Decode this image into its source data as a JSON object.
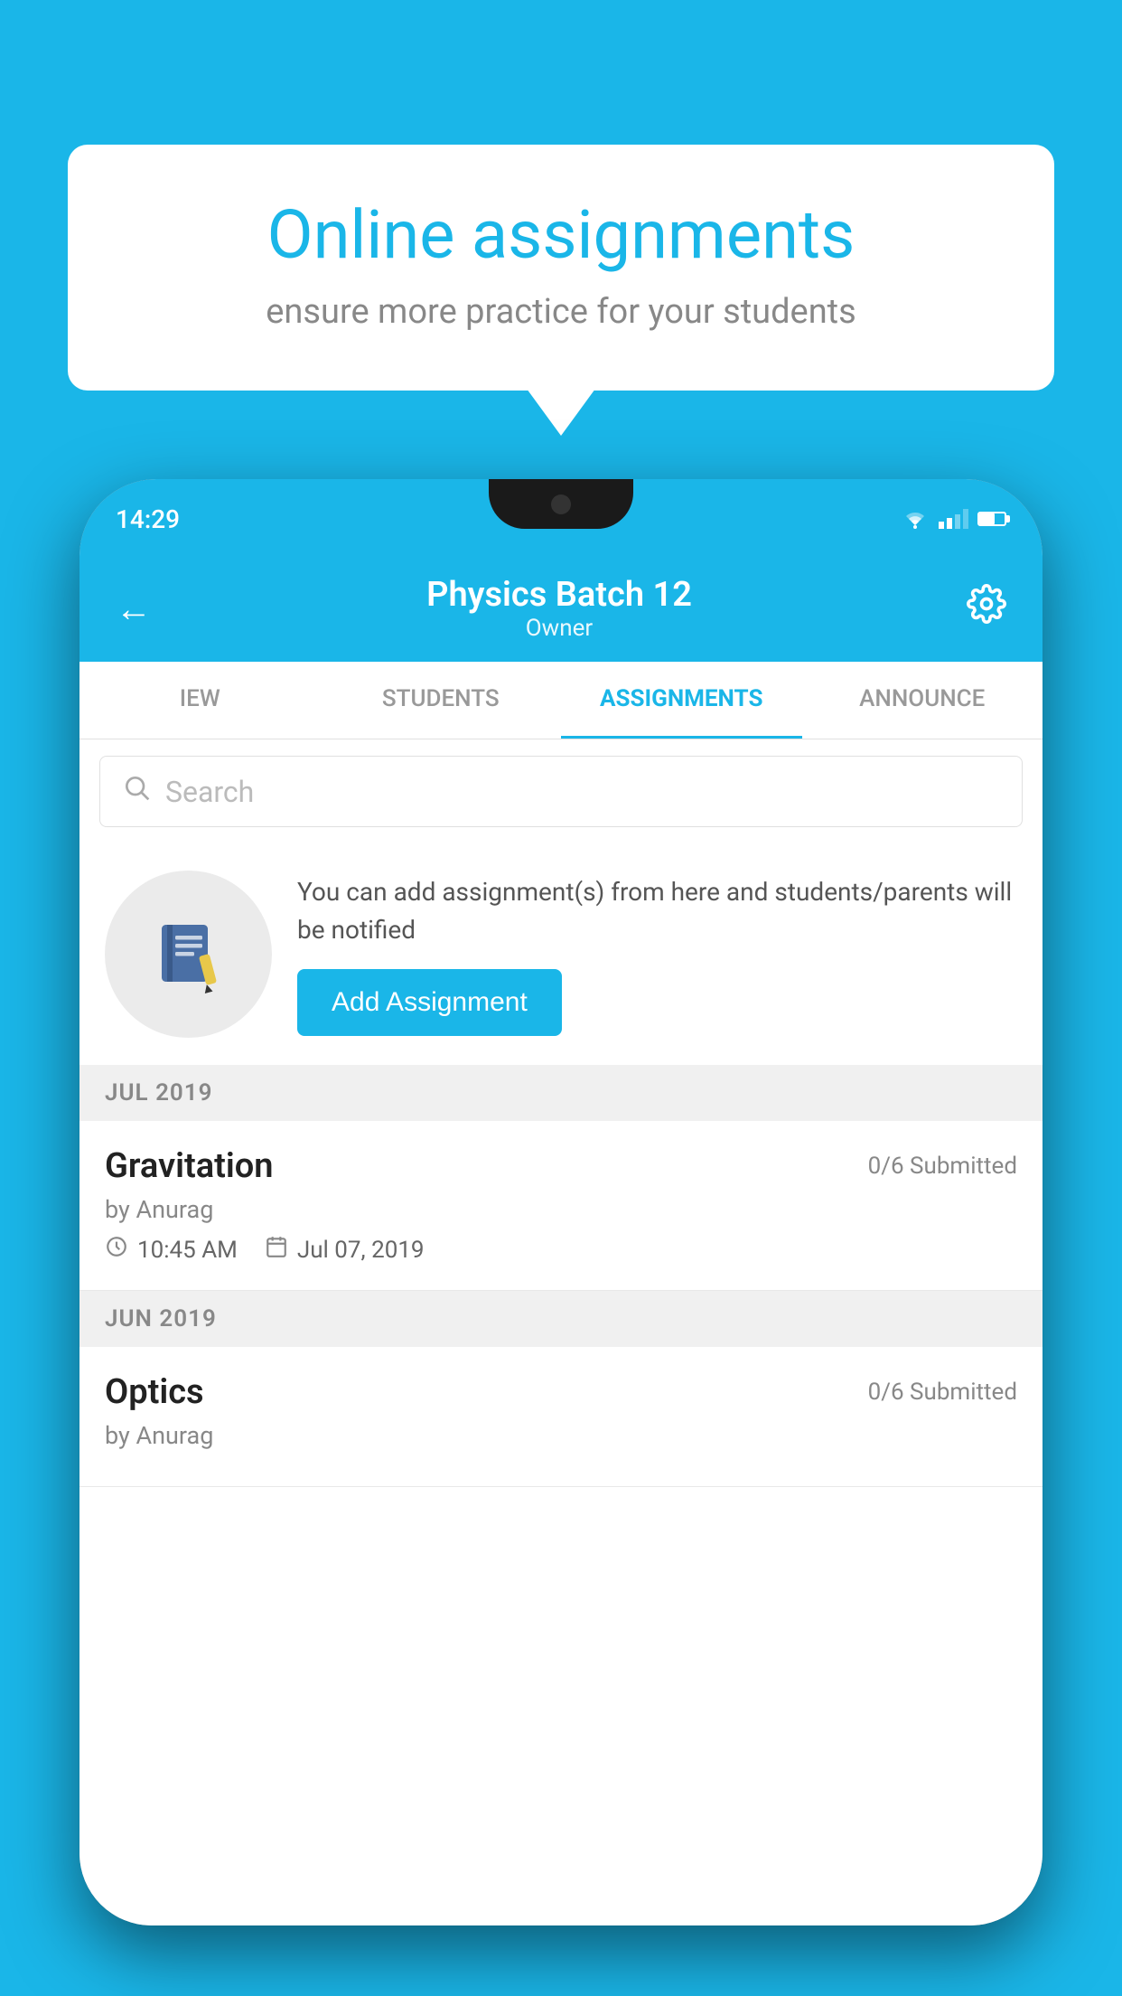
{
  "background_color": "#1ab6e8",
  "tooltip": {
    "title": "Online assignments",
    "subtitle": "ensure more practice for your students"
  },
  "phone": {
    "status_bar": {
      "time": "14:29"
    },
    "header": {
      "title": "Physics Batch 12",
      "subtitle": "Owner",
      "back_label": "←",
      "gear_label": "⚙"
    },
    "tabs": [
      {
        "label": "IEW",
        "active": false
      },
      {
        "label": "STUDENTS",
        "active": false
      },
      {
        "label": "ASSIGNMENTS",
        "active": true
      },
      {
        "label": "ANNOUNCE",
        "active": false
      }
    ],
    "search": {
      "placeholder": "Search"
    },
    "promo": {
      "description": "You can add assignment(s) from here and students/parents will be notified",
      "button_label": "Add Assignment"
    },
    "sections": [
      {
        "month_label": "JUL 2019",
        "assignments": [
          {
            "title": "Gravitation",
            "submitted": "0/6 Submitted",
            "author": "by Anurag",
            "time": "10:45 AM",
            "date": "Jul 07, 2019"
          }
        ]
      },
      {
        "month_label": "JUN 2019",
        "assignments": [
          {
            "title": "Optics",
            "submitted": "0/6 Submitted",
            "author": "by Anurag",
            "time": "",
            "date": ""
          }
        ]
      }
    ]
  }
}
